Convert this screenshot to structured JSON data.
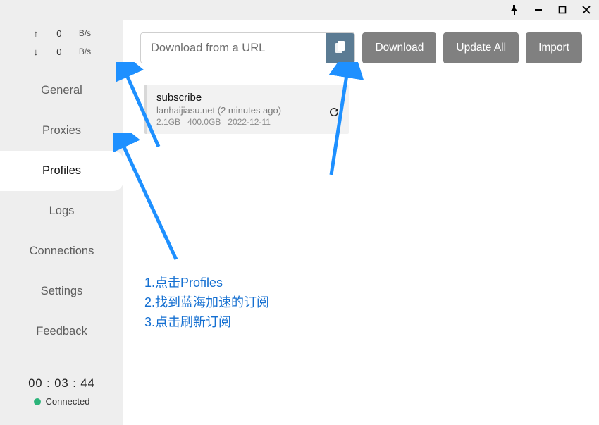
{
  "window": {
    "pin_icon": "pin",
    "min_icon": "minimize",
    "max_icon": "maximize",
    "close_icon": "close"
  },
  "sidebar": {
    "up_value": "0",
    "up_unit": "B/s",
    "down_value": "0",
    "down_unit": "B/s",
    "items": [
      {
        "label": "General"
      },
      {
        "label": "Proxies"
      },
      {
        "label": "Profiles"
      },
      {
        "label": "Logs"
      },
      {
        "label": "Connections"
      },
      {
        "label": "Settings"
      },
      {
        "label": "Feedback"
      }
    ],
    "active_index": 2,
    "status_time": "00 : 03 : 44",
    "status_label": "Connected",
    "status_color": "#2cb47a"
  },
  "toolbar": {
    "url_placeholder": "Download from a URL",
    "url_value": "",
    "download_label": "Download",
    "update_all_label": "Update All",
    "import_label": "Import"
  },
  "profile_card": {
    "title": "subscribe",
    "domain": "lanhaijiasu.net",
    "age": "(2 minutes ago)",
    "used": "2.1GB",
    "total": "400.0GB",
    "expire": "2022-12-11"
  },
  "annotation": {
    "line1": "1.点击Profiles",
    "line2": "2.找到蓝海加速的订阅",
    "line3": "3.点击刷新订阅",
    "color": "#146fd1"
  }
}
